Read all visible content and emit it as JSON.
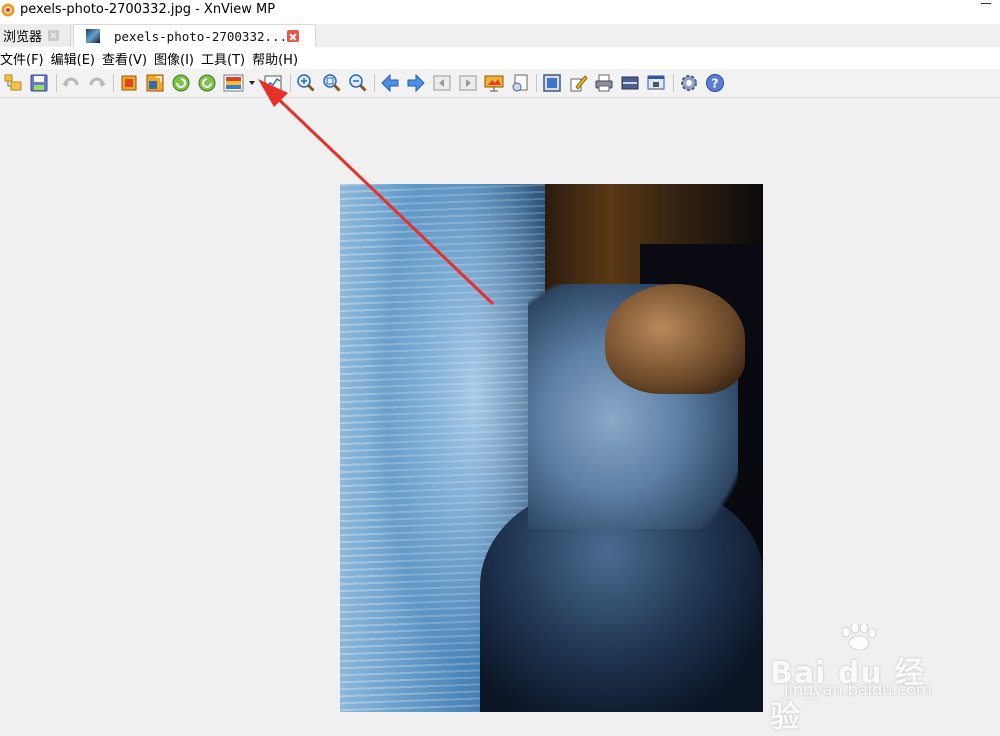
{
  "window": {
    "title": "pexels-photo-2700332.jpg - XnView MP"
  },
  "tabs": [
    {
      "label": "浏览器",
      "active": false
    },
    {
      "label": "pexels-photo-2700332...",
      "active": true
    }
  ],
  "menu": [
    {
      "label": "文件(F)"
    },
    {
      "label": "编辑(E)"
    },
    {
      "label": "查看(V)"
    },
    {
      "label": "图像(I)"
    },
    {
      "label": "工具(T)"
    },
    {
      "label": "帮助(H)"
    }
  ],
  "toolbar_icons": [
    "browse-icon",
    "save-icon",
    "undo-icon",
    "redo-icon",
    "crop-icon",
    "resize-icon",
    "rotate-left-icon",
    "rotate-right-icon",
    "adjust-dropdown-icon",
    "histogram-icon",
    "zoom-in-icon",
    "zoom-fit-icon",
    "zoom-out-icon",
    "previous-icon",
    "next-icon",
    "first-icon",
    "last-icon",
    "slideshow-icon",
    "page-icon",
    "fullscreen-icon",
    "edit-icon",
    "print-icon",
    "scan-icon",
    "screenshot-icon",
    "settings-icon",
    "help-icon"
  ],
  "watermark": {
    "logo": "Bai du 经验",
    "url": "jingyan.baidu.com"
  },
  "colors": {
    "accent_arrow": "#e8302a",
    "tab_close": "#e8554a"
  }
}
